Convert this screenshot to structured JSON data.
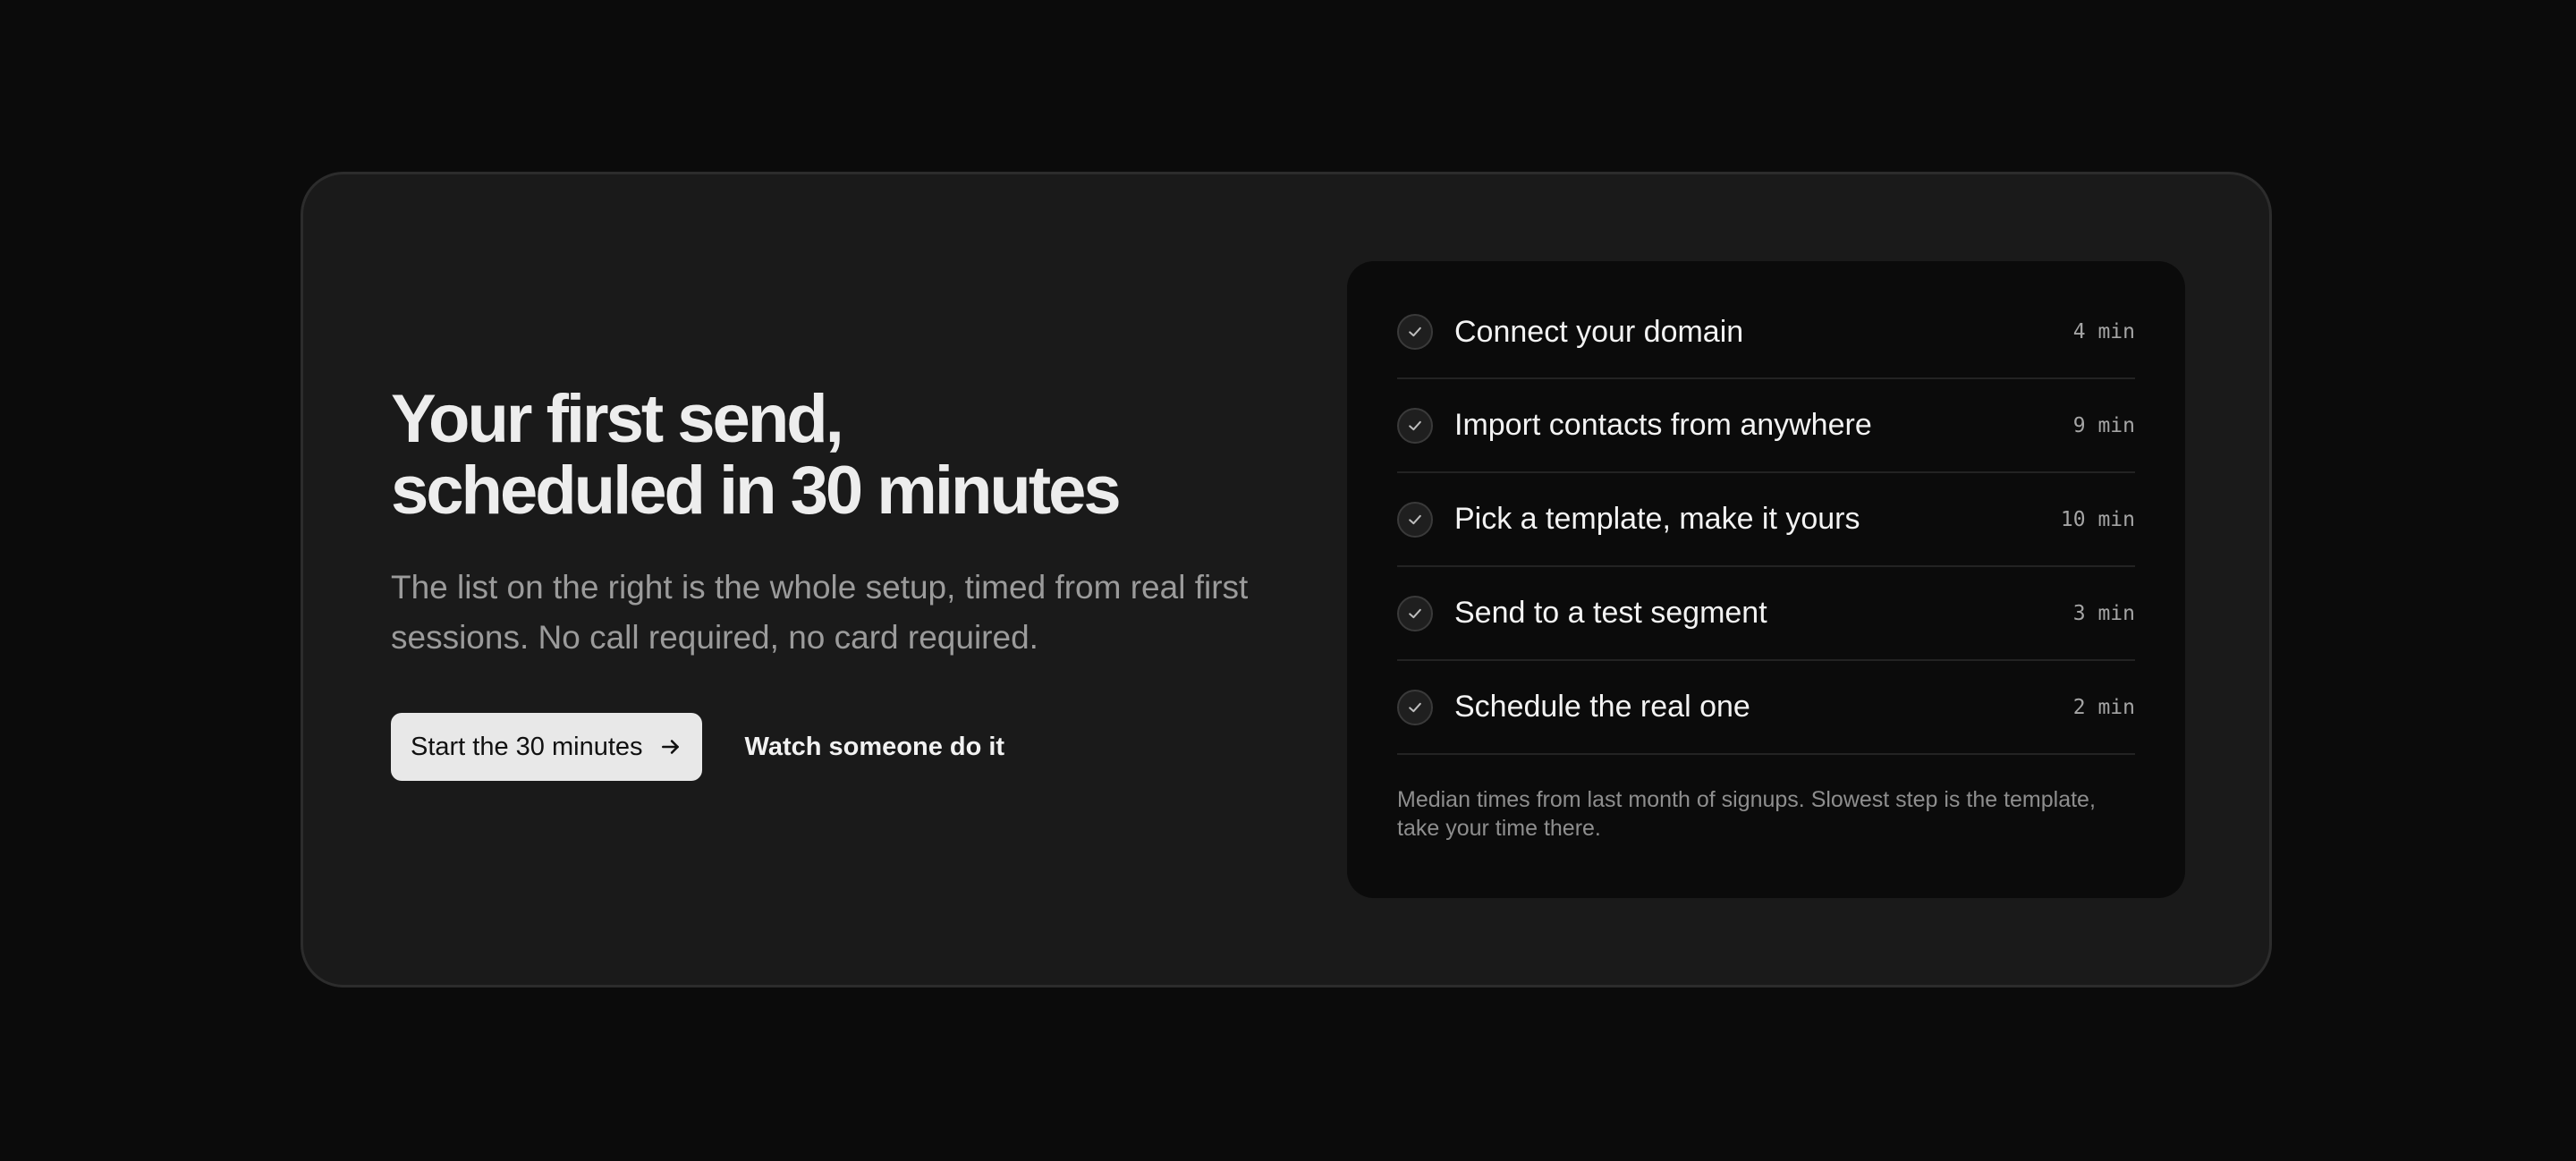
{
  "hero": {
    "headline_line1": "Your first send,",
    "headline_line2": "scheduled in 30 minutes",
    "subtitle": "The list on the right is the whole setup, timed from real first sessions. No call required, no card required.",
    "primary_button": "Start the 30 minutes",
    "secondary_button": "Watch someone do it"
  },
  "checklist": {
    "steps": [
      {
        "label": "Connect your domain",
        "time": "4 min"
      },
      {
        "label": "Import contacts from anywhere",
        "time": "9 min"
      },
      {
        "label": "Pick a template, make it yours",
        "time": "10 min"
      },
      {
        "label": "Send to a test segment",
        "time": "3 min"
      },
      {
        "label": "Schedule the real one",
        "time": "2 min"
      }
    ],
    "footnote": "Median times from last month of signups. Slowest step is the template, take your time there."
  },
  "icons": {
    "check": "check-icon",
    "arrow": "arrow-right-icon"
  }
}
